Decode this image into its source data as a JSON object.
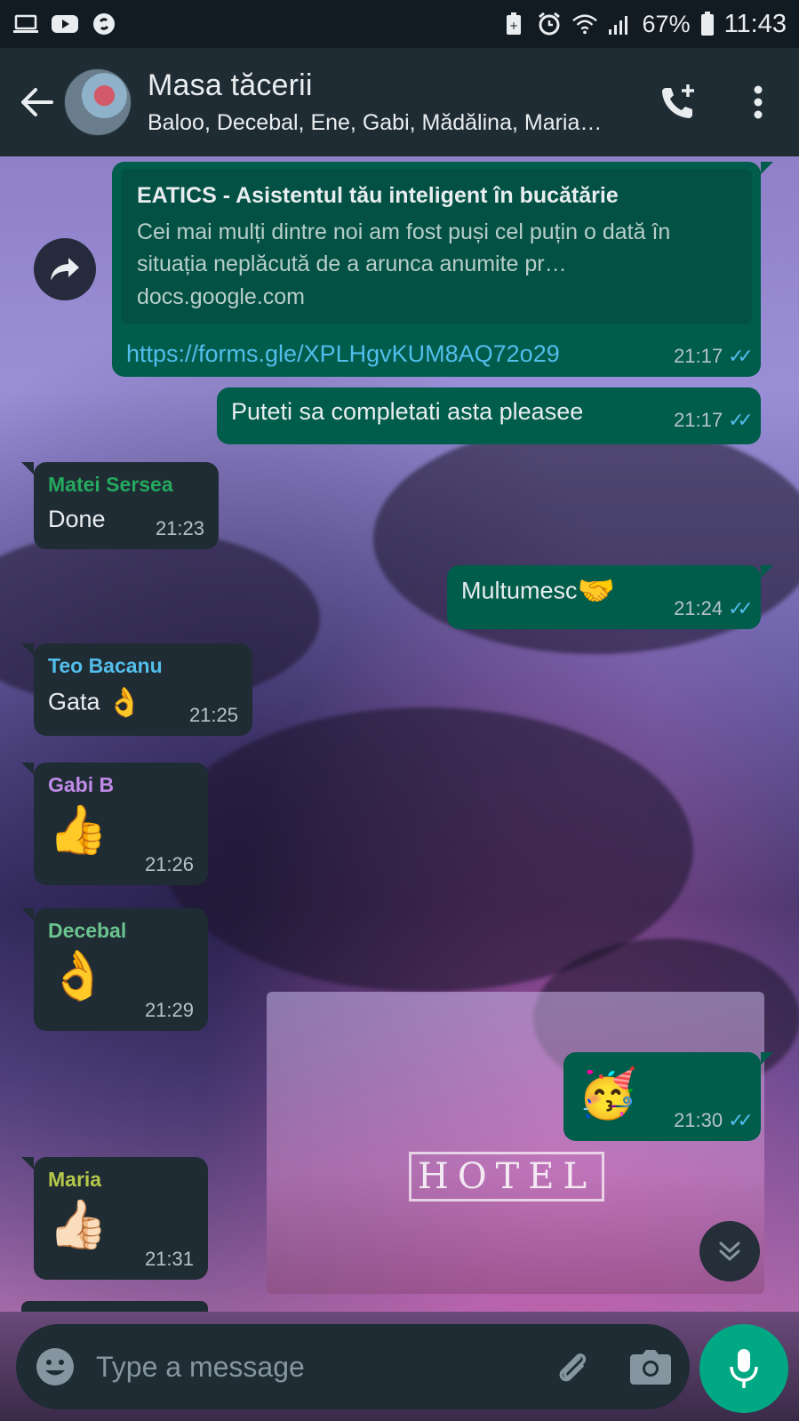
{
  "status_bar": {
    "battery": "67%",
    "time": "11:43",
    "left_icons": [
      "laptop-icon",
      "youtube-icon",
      "shazam-icon"
    ],
    "right_icons": [
      "battery-saver-icon",
      "alarm-icon",
      "wifi-icon",
      "signal-icon",
      "battery-icon"
    ]
  },
  "header": {
    "title": "Masa tăcerii",
    "subtitle": "Baloo, Decebal, Ene, Gabi, Mădălina, Maria…"
  },
  "messages": [
    {
      "id": "m1",
      "direction": "out",
      "link_preview": {
        "title": "EATICS - Asistentul tău inteligent în bucătărie",
        "description": "Cei mai mulți dintre noi am fost puși cel puțin o dată în situația neplăcută de a arunca anumite pr…",
        "domain": "docs.google.com"
      },
      "link": "https://forms.gle/XPLHgvKUM8AQ72o29",
      "time": "21:17",
      "ticks": "✓✓"
    },
    {
      "id": "m2",
      "direction": "out",
      "text": "Puteti sa completati asta pleasee",
      "time": "21:17",
      "ticks": "✓✓"
    },
    {
      "id": "m3",
      "direction": "in",
      "sender": "Matei Sersea",
      "sender_color": "#25a95f",
      "text": "Done",
      "time": "21:23"
    },
    {
      "id": "m4",
      "direction": "out",
      "text": "Multumesc",
      "emoji": "🤝",
      "time": "21:24",
      "ticks": "✓✓"
    },
    {
      "id": "m5",
      "direction": "in",
      "sender": "Teo Bacanu",
      "sender_color": "#53bdeb",
      "text": "Gata",
      "emoji": "👌",
      "time": "21:25"
    },
    {
      "id": "m6",
      "direction": "in",
      "sender": "Gabi B",
      "sender_color": "#c08ae8",
      "emoji": "👍",
      "time": "21:26"
    },
    {
      "id": "m7",
      "direction": "in",
      "sender": "Decebal",
      "sender_color": "#6bc48f",
      "emoji": "👌",
      "time": "21:29"
    },
    {
      "id": "m8",
      "direction": "out",
      "emoji": "🥳",
      "time": "21:30",
      "ticks": "✓✓"
    },
    {
      "id": "m9",
      "direction": "in",
      "sender": "Maria",
      "sender_color": "#b5c84a",
      "emoji": "👍🏻",
      "time": "21:31"
    }
  ],
  "input": {
    "placeholder": "Type a message"
  },
  "colors": {
    "outgoing_bubble": "#005c4b",
    "incoming_bubble": "#1f2c34",
    "accent": "#00a884",
    "tick_read": "#53bdeb"
  }
}
